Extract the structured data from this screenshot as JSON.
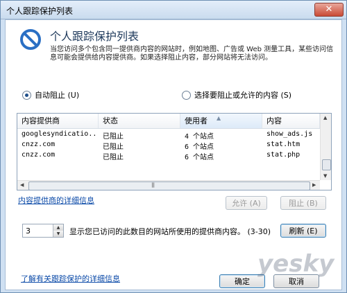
{
  "window": {
    "title": "个人跟踪保护列表",
    "close_label": "✕"
  },
  "header": {
    "title": "个人跟踪保护列表",
    "description": "当您访问多个包含同一提供商内容的网站时，例如地图、广告或 Web 测量工具，某些访问信息可能会提供给内容提供商。如果选择阻止内容，部分网站将无法访问。"
  },
  "options": {
    "auto_block": "自动阻止 (U)",
    "choose": "选择要阻止或允许的内容 (S)",
    "selected": "auto_block"
  },
  "table": {
    "columns": [
      "内容提供商",
      "状态",
      "使用者",
      "内容"
    ],
    "rows": [
      {
        "provider": "googlesyndicatio...",
        "status": "已阻止",
        "used_by": "4 个站点",
        "content": "show_ads.js"
      },
      {
        "provider": "cnzz.com",
        "status": "已阻止",
        "used_by": "6 个站点",
        "content": "stat.htm"
      },
      {
        "provider": "cnzz.com",
        "status": "已阻止",
        "used_by": "6 个站点",
        "content": "stat.php"
      }
    ]
  },
  "links": {
    "provider_details": "内容提供商的详细信息",
    "learn_more": "了解有关跟踪保护的详细信息"
  },
  "buttons": {
    "allow": "允许 (A)",
    "block": "阻止 (B)",
    "refresh": "刷新 (E)",
    "ok": "确定",
    "cancel": "取消"
  },
  "threshold": {
    "value": "3",
    "label": "显示您已访问的此数目的网站所使用的提供商内容。 (3-30)"
  },
  "watermark": "yesky",
  "colors": {
    "title_text": "#1e395b",
    "link": "#0b4aa8",
    "window_frame": "#cfe0f2"
  }
}
